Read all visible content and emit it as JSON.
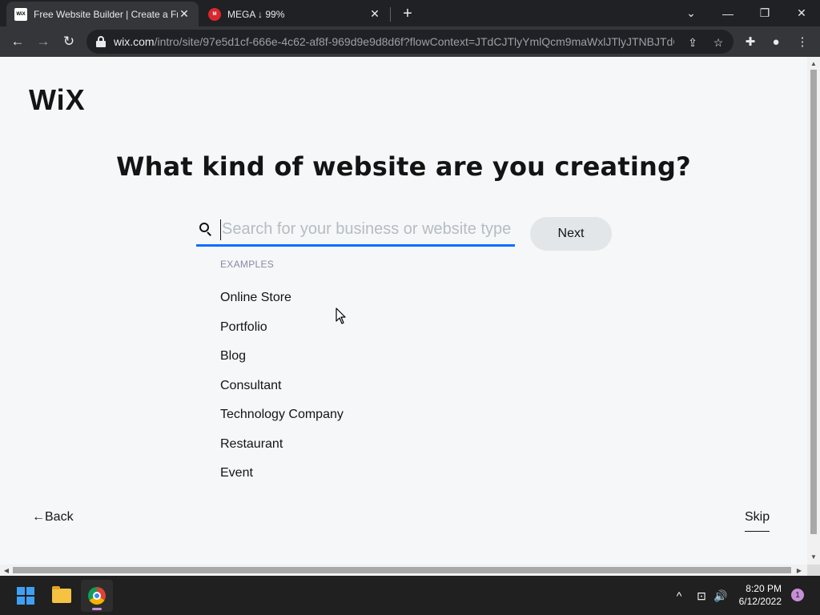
{
  "browser": {
    "tabs": [
      {
        "favicon": "wix-favicon",
        "favicon_text": "WiX",
        "title": "Free Website Builder | Create a Fr",
        "close": "✕"
      },
      {
        "favicon": "mega-favicon",
        "favicon_text": "M",
        "title": "MEGA ↓ 99%",
        "close": "✕"
      }
    ],
    "new_tab": "+",
    "window_controls": {
      "tab_search": "⌄",
      "minimize": "—",
      "restore": "❐",
      "close": "✕"
    },
    "nav": {
      "back": "←",
      "forward": "→",
      "reload": "↻"
    },
    "url_host": "wix.com",
    "url_path": "/intro/site/97e5d1cf-666e-4c62-af8f-969d9e9d8d6f?flowContext=JTdCJTlyYmlQcm9maWxlJTlyJTNBJTdC...",
    "omnibox_icons": {
      "share": "⇪",
      "bookmark": "☆"
    },
    "toolbar_icons": {
      "extensions": "✚",
      "profile": "●",
      "menu": "⋮"
    }
  },
  "page": {
    "logo": "WiX",
    "heading": "What kind of website are you creating?",
    "search": {
      "placeholder": "Search for your business or website type",
      "value": ""
    },
    "next_label": "Next",
    "examples_label": "EXAMPLES",
    "examples": [
      "Online Store",
      "Portfolio",
      "Blog",
      "Consultant",
      "Technology Company",
      "Restaurant",
      "Event"
    ],
    "back_label": "←Back",
    "skip_label": "Skip"
  },
  "scrollbars": {
    "up": "▲",
    "down": "▼",
    "left": "◀",
    "right": "▶"
  },
  "taskbar": {
    "tray": {
      "chevron": "^",
      "network": "⊡",
      "volume": "🔊"
    },
    "time": "8:20 PM",
    "date": "6/12/2022",
    "notifications": "1"
  },
  "colors": {
    "accent": "#116dff",
    "page_bg": "#f5f7f8",
    "next_bg": "#e3e6e9"
  }
}
